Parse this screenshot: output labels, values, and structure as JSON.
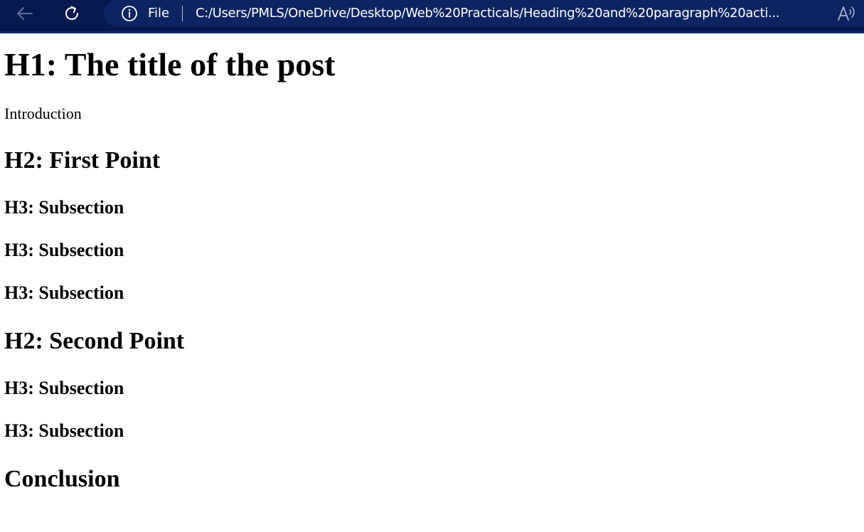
{
  "browser": {
    "toolbar_color": "#061a4d",
    "address_bar_color": "#0c2460",
    "icons": {
      "back": "back-arrow-icon",
      "reload": "reload-icon",
      "info": "info-icon",
      "read_aloud": "read-aloud-icon"
    },
    "scheme_label": "File",
    "url": "C:/Users/PMLS/OneDrive/Desktop/Web%20Practicals/Heading%20and%20paragraph%20acti..."
  },
  "page": {
    "h1": "H1: The title of the post",
    "intro": "Introduction",
    "sections": [
      {
        "heading": "H2: First Point",
        "subsections": [
          "H3: Subsection",
          "H3: Subsection",
          "H3: Subsection"
        ]
      },
      {
        "heading": "H2: Second Point",
        "subsections": [
          "H3: Subsection",
          "H3: Subsection"
        ]
      }
    ],
    "conclusion": "Conclusion"
  }
}
